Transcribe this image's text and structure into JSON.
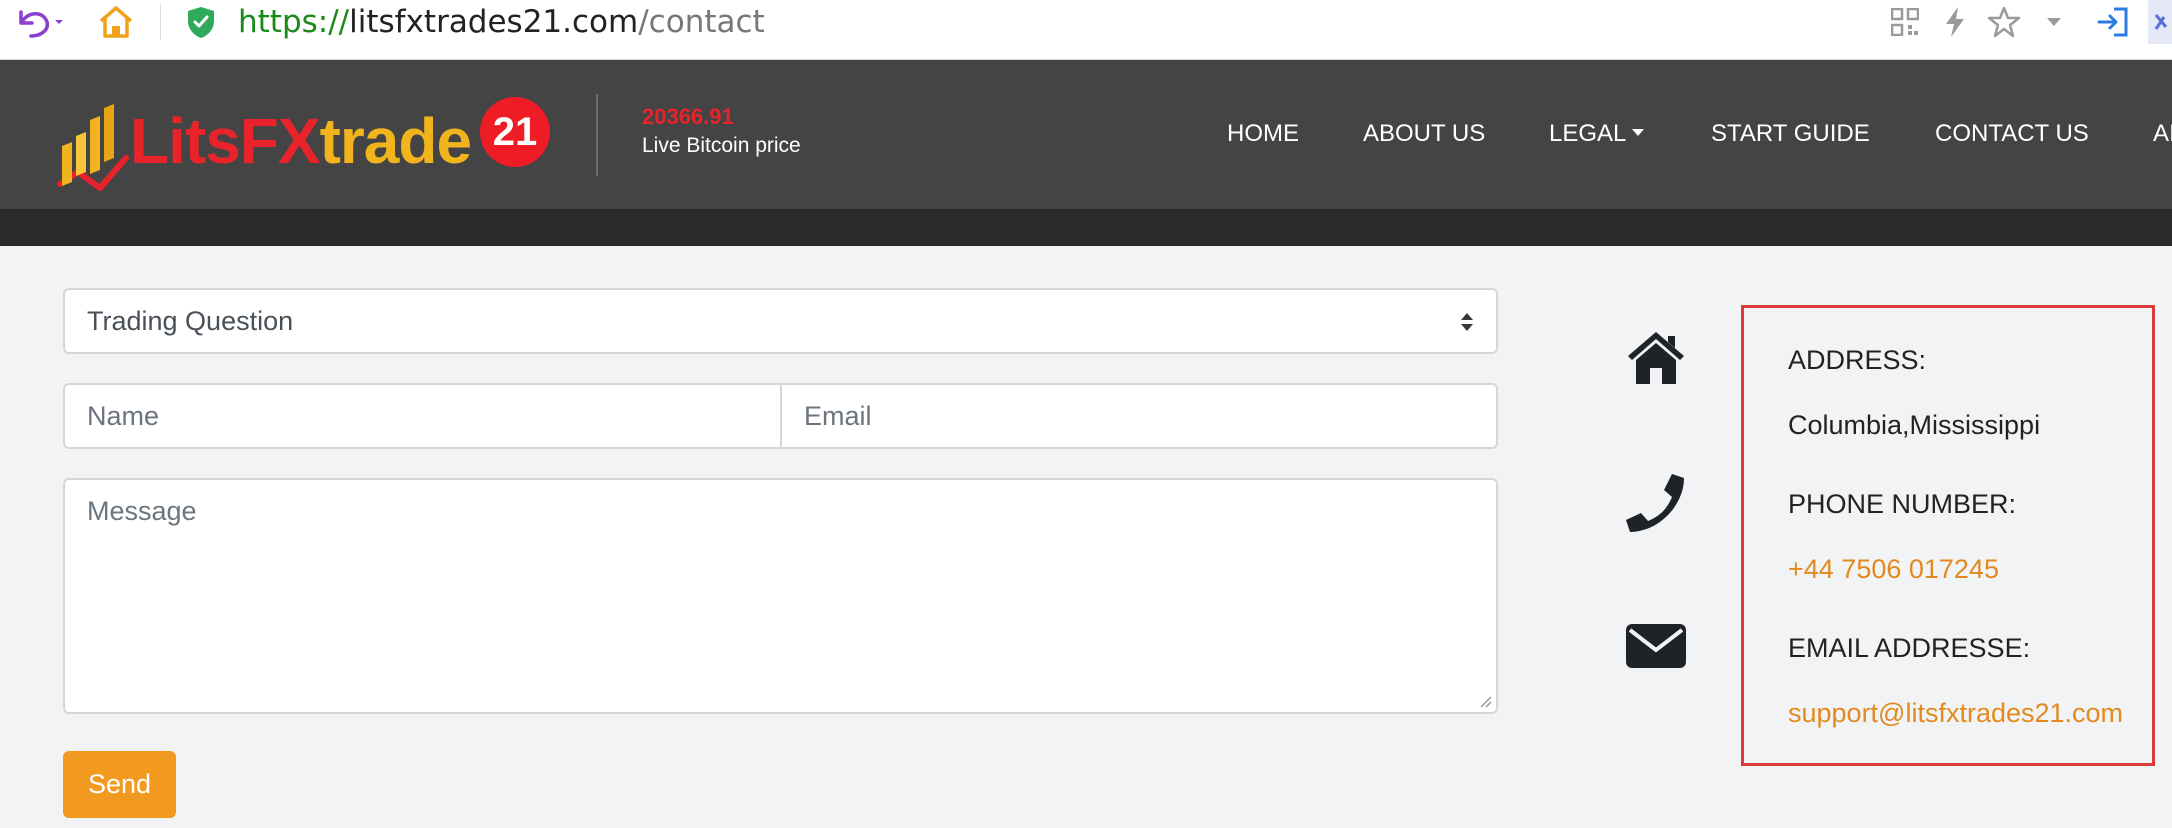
{
  "browser": {
    "url_scheme": "https://",
    "url_host": "litsfxtrades21.com",
    "url_path": "/contact"
  },
  "header": {
    "logo_part1": "LitsFX",
    "logo_part2": "trade",
    "logo_badge": "21",
    "btc_price": "20366.91",
    "btc_label": "Live Bitcoin price",
    "nav": {
      "home": "HOME",
      "about": "ABOUT US",
      "legal": "LEGAL",
      "start_guide": "START GUIDE",
      "contact": "CONTACT US",
      "partial": "AI"
    }
  },
  "form": {
    "subject_selected": "Trading Question",
    "name_placeholder": "Name",
    "email_placeholder": "Email",
    "message_placeholder": "Message",
    "send_label": "Send"
  },
  "contact_info": {
    "address_label": "ADDRESS:",
    "address_value": "Columbia,Mississippi",
    "phone_label": "PHONE NUMBER:",
    "phone_value": "+44 7506 017245",
    "email_label": "EMAIL ADDRESSE:",
    "email_value": "support@litsfxtrades21.com"
  },
  "colors": {
    "header_bg": "#444444",
    "accent_orange": "#f29a1f",
    "brand_red": "#e8232b",
    "brand_yellow": "#f2b41c",
    "highlight_box": "#dd3b3b"
  },
  "icons": {
    "address": "home-icon",
    "phone": "phone-icon",
    "email": "envelope-icon"
  }
}
